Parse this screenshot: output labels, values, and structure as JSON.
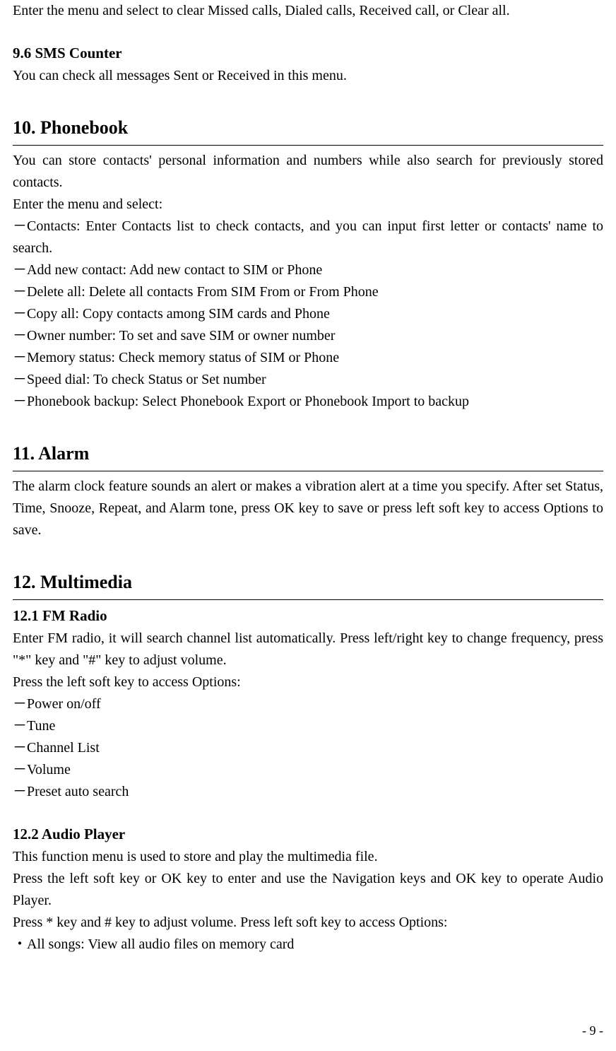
{
  "intro_line": "Enter the menu and select to clear Missed calls, Dialed calls, Received call, or Clear all.",
  "sec96": {
    "heading": "9.6 SMS Counter",
    "body": "You can check all messages Sent or Received in this menu."
  },
  "sec10": {
    "heading": "10. Phonebook",
    "p1": "You can store contacts' personal information and numbers while also search for previously stored contacts.",
    "p2": "Enter the menu and select:",
    "items": [
      "－Contacts: Enter Contacts list to check contacts, and you can input first letter or contacts' name to search.",
      "－Add new contact: Add new contact to SIM or Phone",
      "－Delete all: Delete all contacts From SIM From or From Phone",
      "－Copy all: Copy contacts among SIM cards and Phone",
      "－Owner number: To set and save SIM or owner number",
      "－Memory status: Check memory status of SIM or Phone",
      "－Speed dial: To check Status or Set number",
      "－Phonebook backup: Select Phonebook Export or Phonebook Import to backup"
    ]
  },
  "sec11": {
    "heading": "11. Alarm",
    "body": "The alarm clock feature sounds an alert or makes a vibration alert at a time you specify. After set Status, Time, Snooze, Repeat, and Alarm tone, press OK key to save or press left soft key to access Options to save."
  },
  "sec12": {
    "heading": "12. Multimedia",
    "s121": {
      "heading": "12.1 FM Radio",
      "p1": "Enter FM radio, it will search channel list automatically. Press left/right key to change frequency, press \"*\" key and \"#\" key to adjust volume.",
      "p2": "Press the left soft key to access Options:",
      "items": [
        "－Power on/off",
        "－Tune",
        "－Channel List",
        "－Volume",
        "－Preset auto search"
      ]
    },
    "s122": {
      "heading": "12.2 Audio Player",
      "p1": "This function menu is used to store and play the multimedia file.",
      "p2": "Press the left soft key or OK key to enter and use the Navigation keys and OK key to operate Audio Player.",
      "p3": "Press * key and # key to adjust volume. Press left soft key to access Options:",
      "items": [
        "・All songs: View all audio files on memory card"
      ]
    }
  },
  "page_number": "- 9 -"
}
